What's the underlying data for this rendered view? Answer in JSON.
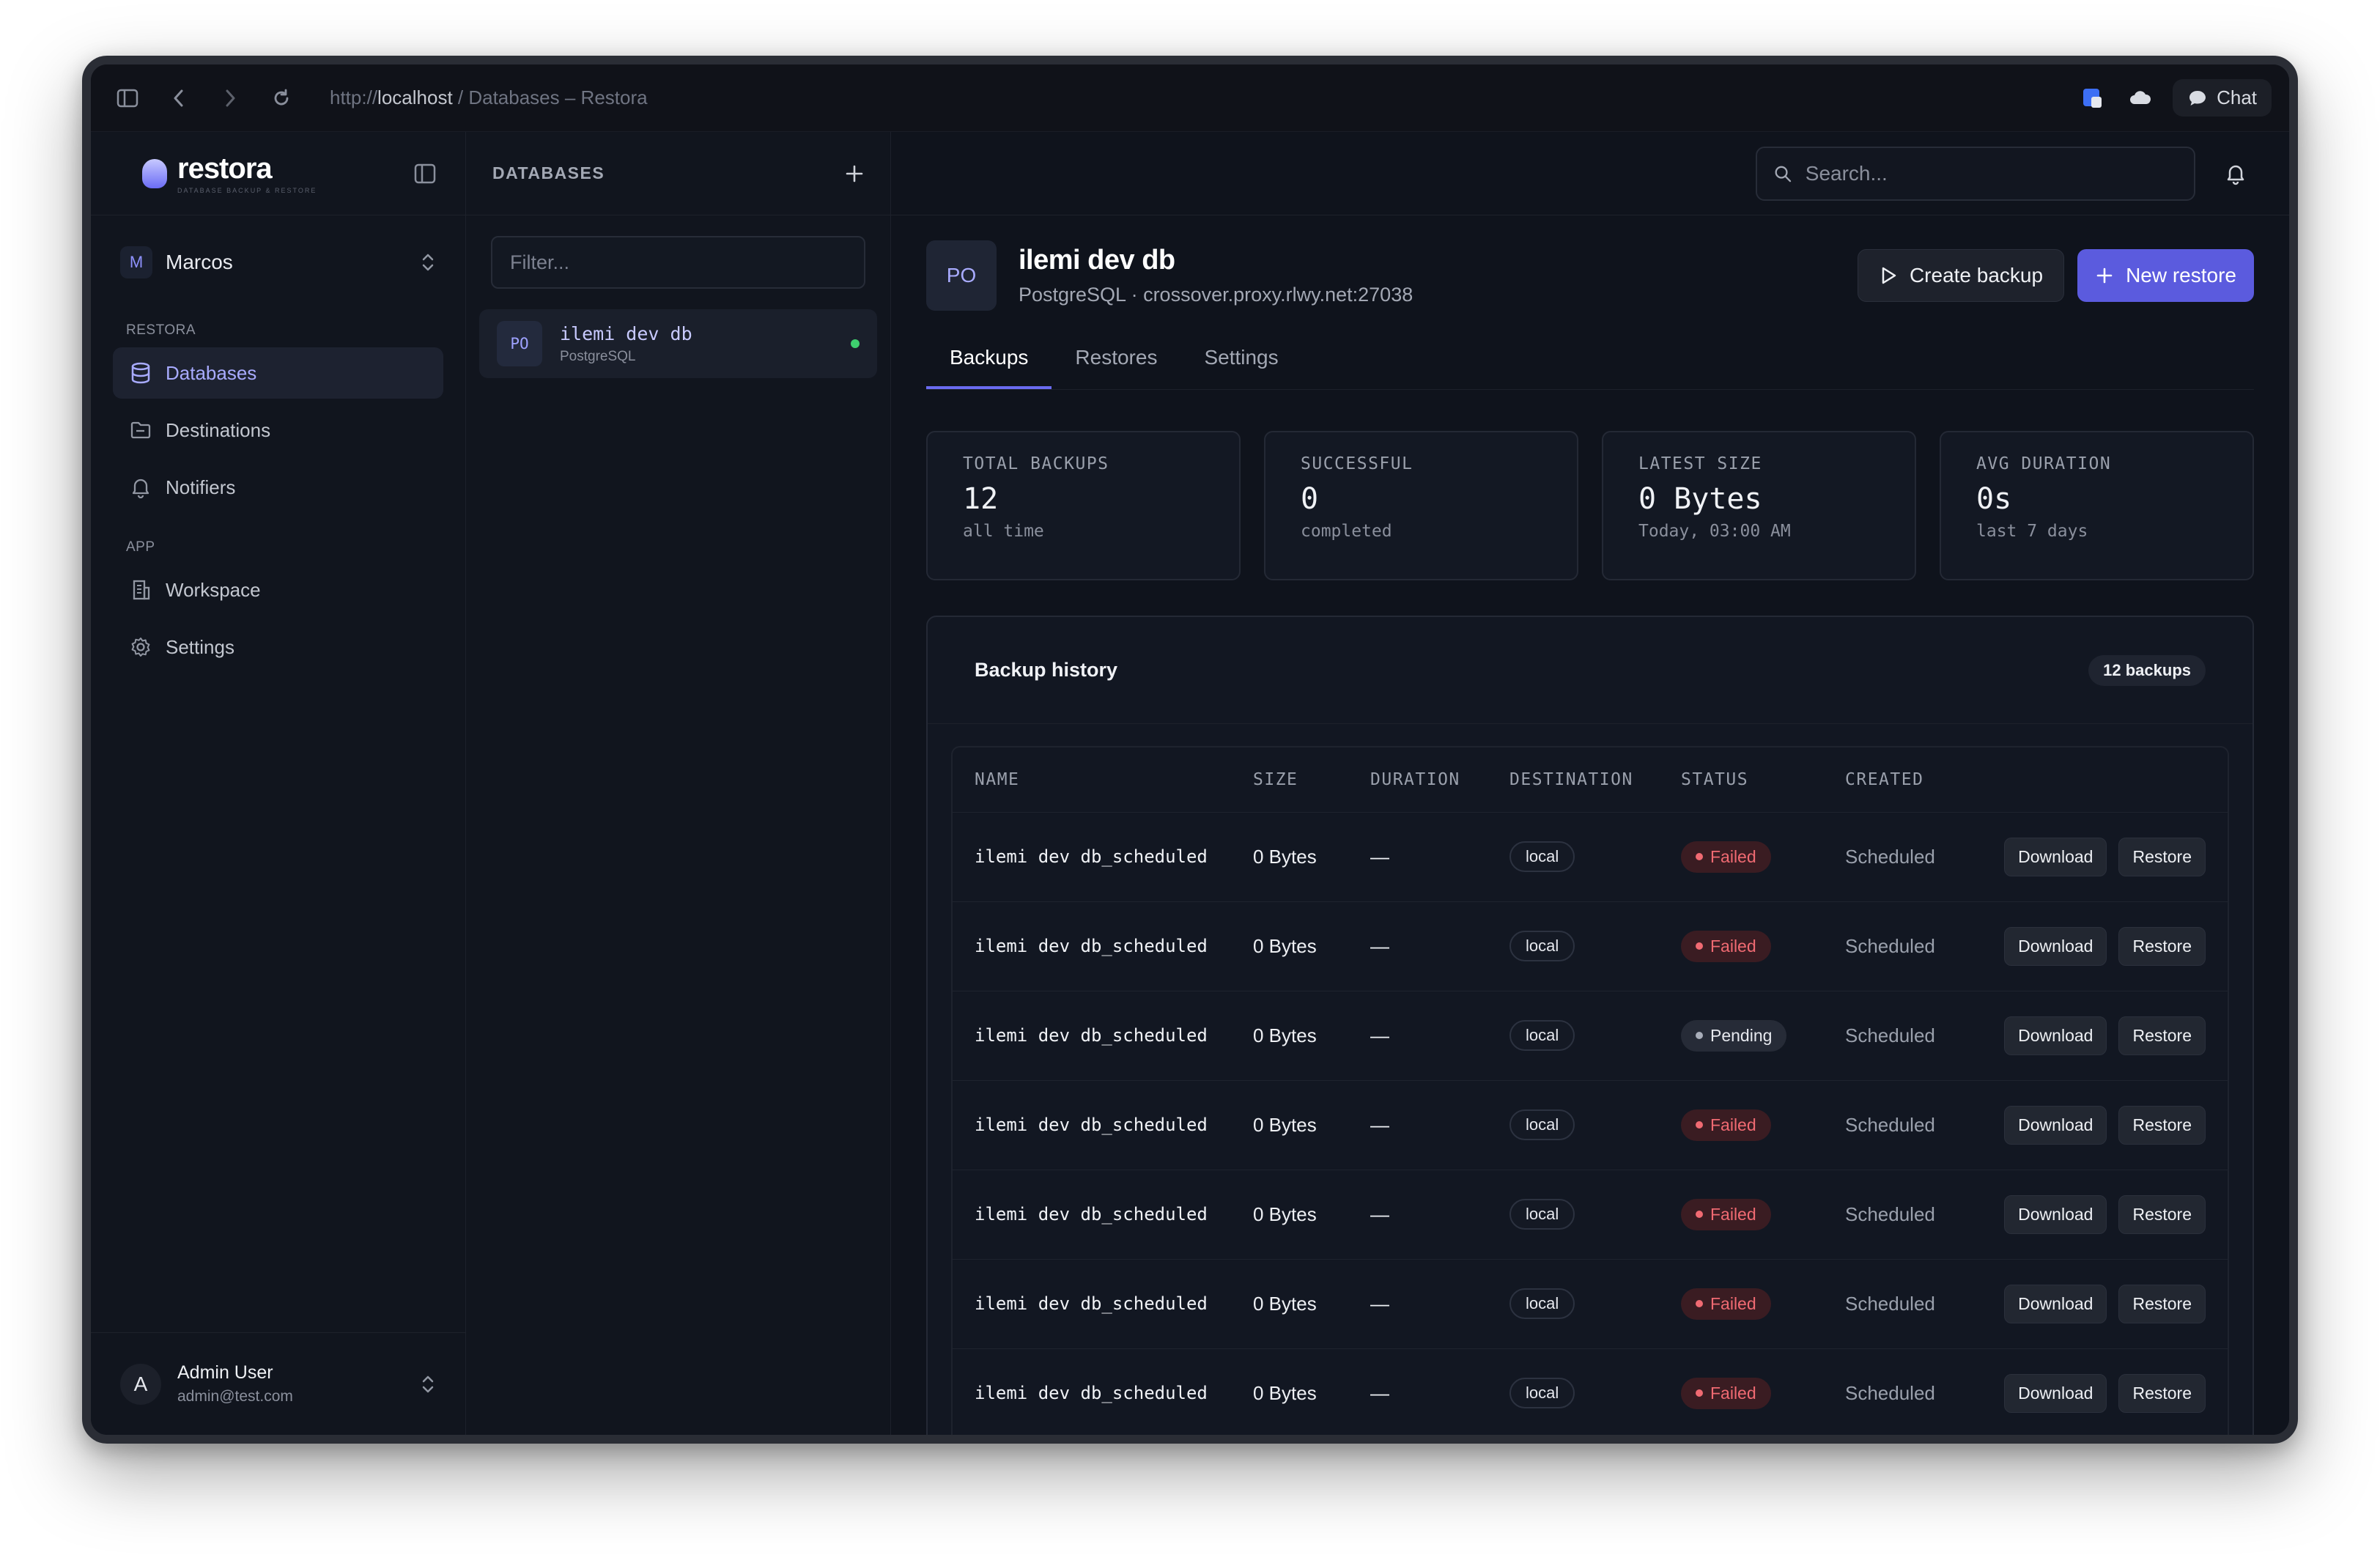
{
  "browser": {
    "url_scheme": "http://",
    "url_host": "localhost",
    "url_rest": " / Databases – Restora",
    "chat_label": "Chat"
  },
  "sidebar": {
    "brand_name": "restora",
    "brand_tagline": "DATABASE BACKUP & RESTORE",
    "workspace_initial": "M",
    "workspace_name": "Marcos",
    "sections": [
      {
        "title": "RESTORA",
        "items": [
          {
            "label": "Databases",
            "icon": "database-icon",
            "active": true
          },
          {
            "label": "Destinations",
            "icon": "folder-icon",
            "active": false
          },
          {
            "label": "Notifiers",
            "icon": "bell-icon",
            "active": false
          }
        ]
      },
      {
        "title": "APP",
        "items": [
          {
            "label": "Workspace",
            "icon": "building-icon",
            "active": false
          },
          {
            "label": "Settings",
            "icon": "gear-icon",
            "active": false
          }
        ]
      }
    ],
    "user": {
      "initial": "A",
      "name": "Admin User",
      "email": "admin@test.com"
    }
  },
  "dbcol": {
    "title": "DATABASES",
    "filter_placeholder": "Filter...",
    "items": [
      {
        "badge": "PO",
        "name": "ilemi dev db",
        "type": "PostgreSQL",
        "status_color": "#3ecf6e"
      }
    ]
  },
  "topbar": {
    "search_placeholder": "Search..."
  },
  "header": {
    "badge": "PO",
    "title": "ilemi dev db",
    "subtitle": "PostgreSQL · crossover.proxy.rlwy.net:27038",
    "create_backup_label": "Create backup",
    "new_restore_label": "New restore"
  },
  "tabs": [
    {
      "label": "Backups",
      "active": true
    },
    {
      "label": "Restores",
      "active": false
    },
    {
      "label": "Settings",
      "active": false
    }
  ],
  "stats": [
    {
      "label": "TOTAL BACKUPS",
      "value": "12",
      "sub": "all time"
    },
    {
      "label": "SUCCESSFUL",
      "value": "0",
      "sub": "completed"
    },
    {
      "label": "LATEST SIZE",
      "value": "0 Bytes",
      "sub": "Today, 03:00 AM"
    },
    {
      "label": "AVG DURATION",
      "value": "0s",
      "sub": "last 7 days"
    }
  ],
  "history": {
    "title": "Backup history",
    "count_label": "12 backups",
    "columns": [
      "NAME",
      "SIZE",
      "DURATION",
      "DESTINATION",
      "STATUS",
      "CREATED"
    ],
    "download_label": "Download",
    "restore_label": "Restore",
    "rows": [
      {
        "name": "ilemi dev db_scheduled",
        "size": "0 Bytes",
        "duration": "—",
        "destination": "local",
        "status": "Failed",
        "created": "Scheduled"
      },
      {
        "name": "ilemi dev db_scheduled",
        "size": "0 Bytes",
        "duration": "—",
        "destination": "local",
        "status": "Failed",
        "created": "Scheduled"
      },
      {
        "name": "ilemi dev db_scheduled",
        "size": "0 Bytes",
        "duration": "—",
        "destination": "local",
        "status": "Pending",
        "created": "Scheduled"
      },
      {
        "name": "ilemi dev db_scheduled",
        "size": "0 Bytes",
        "duration": "—",
        "destination": "local",
        "status": "Failed",
        "created": "Scheduled"
      },
      {
        "name": "ilemi dev db_scheduled",
        "size": "0 Bytes",
        "duration": "—",
        "destination": "local",
        "status": "Failed",
        "created": "Scheduled"
      },
      {
        "name": "ilemi dev db_scheduled",
        "size": "0 Bytes",
        "duration": "—",
        "destination": "local",
        "status": "Failed",
        "created": "Scheduled"
      },
      {
        "name": "ilemi dev db_scheduled",
        "size": "0 Bytes",
        "duration": "—",
        "destination": "local",
        "status": "Failed",
        "created": "Scheduled"
      }
    ]
  },
  "colors": {
    "accent": "#5b5bde",
    "failed": "#f06a72",
    "online": "#3ecf6e",
    "background": "#0f131c"
  }
}
